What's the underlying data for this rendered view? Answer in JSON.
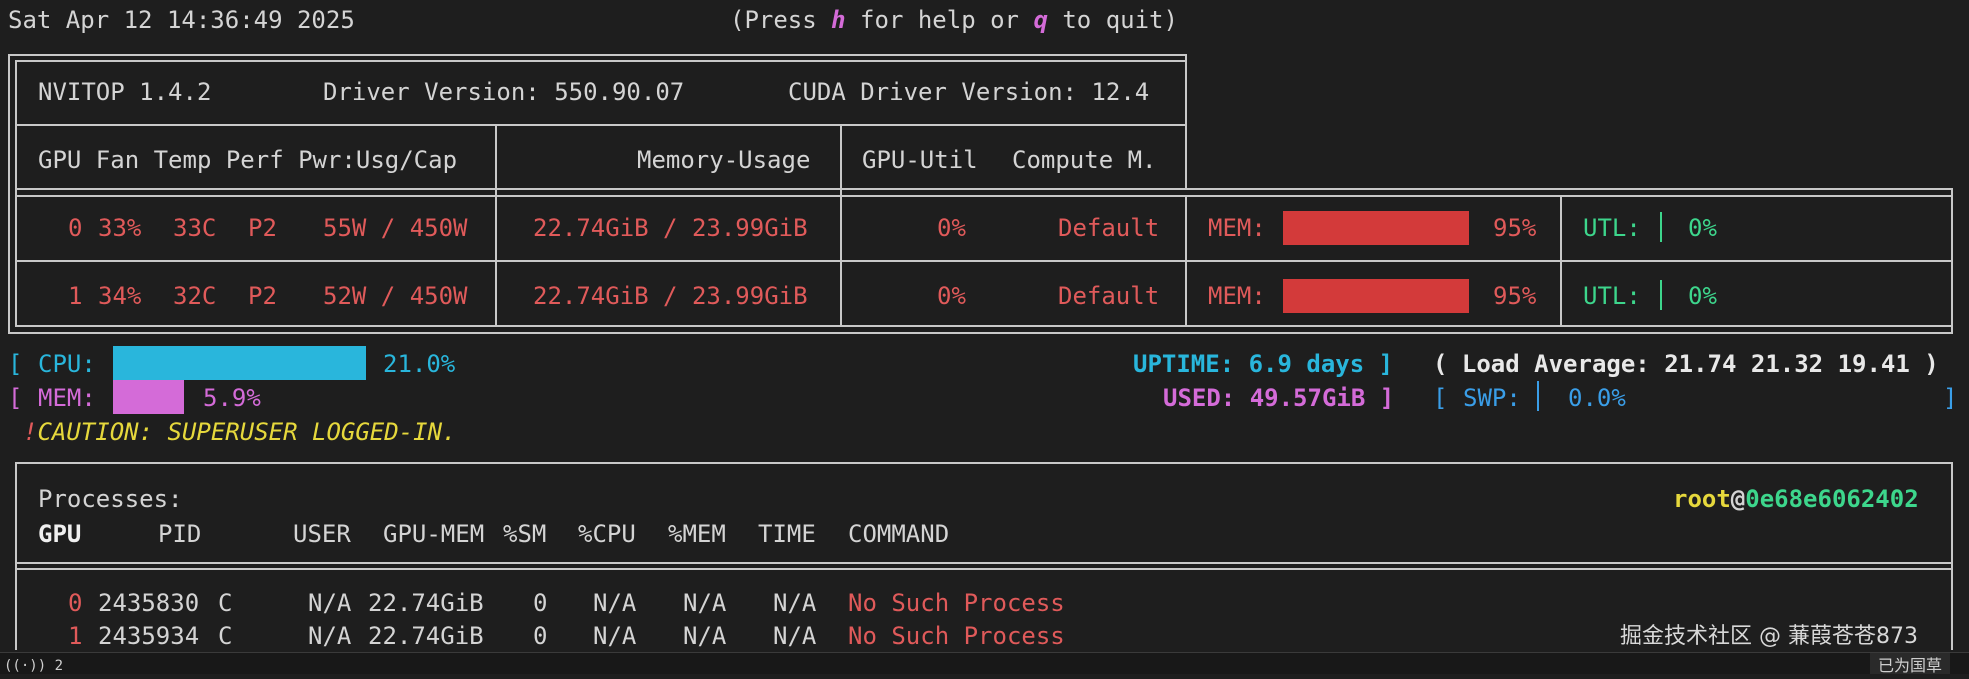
{
  "header": {
    "timestamp": "Sat Apr 12 14:36:49 2025",
    "help_prefix": "(Press ",
    "help_key": "h",
    "help_mid": " for help or ",
    "quit_key": "q",
    "help_suffix": " to quit)"
  },
  "summary": {
    "nvitop": "NVITOP 1.4.2",
    "driver": "Driver Version: 550.90.07",
    "cuda": "CUDA Driver Version: 12.4"
  },
  "gpu_table": {
    "headers": {
      "left": "GPU Fan Temp Perf Pwr:Usg/Cap",
      "memory": "Memory-Usage",
      "util": "GPU-Util",
      "compute": "Compute M."
    },
    "rows": [
      {
        "gpu": "0",
        "fan": "33%",
        "temp": "33C",
        "perf": "P2",
        "power": "55W / 450W",
        "memory": "22.74GiB / 23.99GiB",
        "util": "0%",
        "compute": "Default",
        "mem_label": "MEM:",
        "mem_pct": "95%",
        "mem_fraction": 0.95,
        "utl_label": "UTL:",
        "utl_pct": "0%"
      },
      {
        "gpu": "1",
        "fan": "34%",
        "temp": "32C",
        "perf": "P2",
        "power": "52W / 450W",
        "memory": "22.74GiB / 23.99GiB",
        "util": "0%",
        "compute": "Default",
        "mem_label": "MEM:",
        "mem_pct": "95%",
        "mem_fraction": 0.95,
        "utl_label": "UTL:",
        "utl_pct": "0%"
      }
    ]
  },
  "host": {
    "cpu_label": "CPU:",
    "cpu_pct": "21.0%",
    "cpu_fraction": 0.21,
    "mem_label": "MEM:",
    "mem_pct": "5.9%",
    "mem_fraction": 0.059,
    "uptime_label": "UPTIME:",
    "uptime_value": "6.9 days",
    "load_avg": "( Load Average: 21.74 21.32 19.41 )",
    "used_label": "USED:",
    "used_value": "49.57GiB",
    "swp_label": "SWP:",
    "swp_pct": "0.0%",
    "caution_mark": "!",
    "caution_text": "CAUTION: SUPERUSER LOGGED-IN."
  },
  "processes": {
    "title": "Processes:",
    "user": "root",
    "at": "@",
    "hostname": "0e68e6062402",
    "headers": {
      "gpu": "GPU",
      "pid": "PID",
      "user": "USER",
      "gpu_mem": "GPU-MEM",
      "sm": "%SM",
      "cpu": "%CPU",
      "mem": "%MEM",
      "time": "TIME",
      "command": "COMMAND"
    },
    "rows": [
      {
        "gpu": "0",
        "pid": "2435830",
        "type": "C",
        "user": "N/A",
        "gpu_mem": "22.74GiB",
        "sm": "0",
        "cpu": "N/A",
        "mem": "N/A",
        "time": "N/A",
        "command": "No Such Process"
      },
      {
        "gpu": "1",
        "pid": "2435934",
        "type": "C",
        "user": "N/A",
        "gpu_mem": "22.74GiB",
        "sm": "0",
        "cpu": "N/A",
        "mem": "N/A",
        "time": "N/A",
        "command": "No Such Process"
      }
    ]
  },
  "overlays": {
    "watermark": "掘金技术社区 @ 蒹葭苍苍873",
    "bottom_left": "((·)) 2",
    "bottom_right": "已为国草"
  },
  "colors": {
    "background": "#1e1e1e",
    "border": "#c8c8c8",
    "gpu_red": "#e05a5a",
    "mem_bar": "#d33a3a",
    "cpu_bar": "#29b6dc",
    "host_mem_bar": "#d46bd8",
    "green": "#3dd68c",
    "yellow": "#e6d83c"
  }
}
